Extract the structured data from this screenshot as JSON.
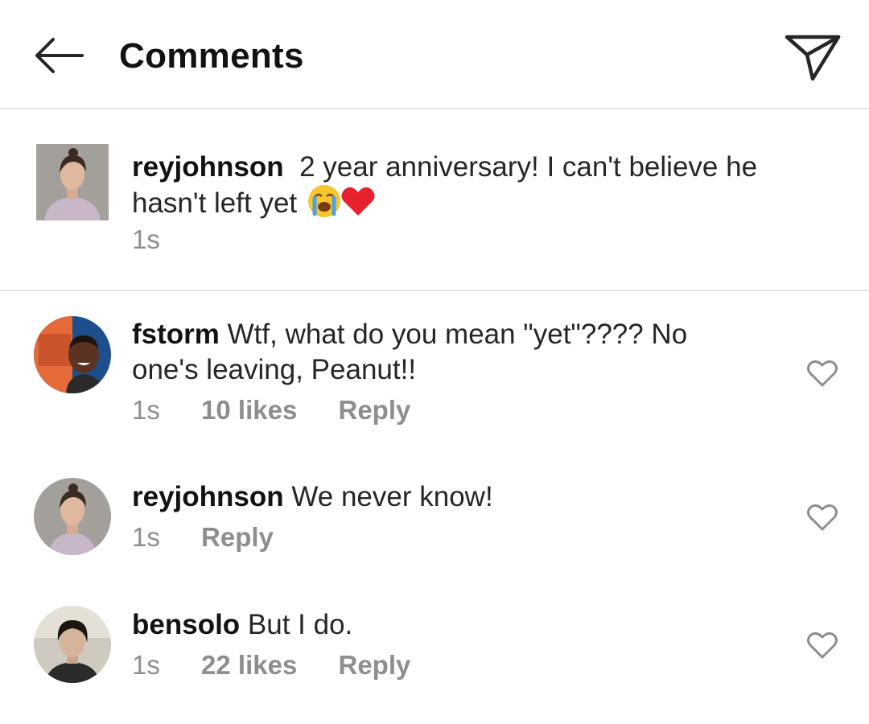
{
  "header": {
    "title": "Comments",
    "back_icon": "arrow-left-icon",
    "send_icon": "paper-plane-icon"
  },
  "caption": {
    "username": "reyjohnson",
    "text": "2 year anniversary! I can't believe he hasn't left yet",
    "emoji": [
      "loudly-crying-face",
      "red-heart"
    ],
    "time": "1s"
  },
  "comments": [
    {
      "username": "fstorm",
      "text": "Wtf, what do you mean \"yet\"???? No one's leaving, Peanut!!",
      "time": "1s",
      "likes": "10 likes",
      "reply": "Reply"
    },
    {
      "username": "reyjohnson",
      "text": "We never know!",
      "time": "1s",
      "reply": "Reply"
    },
    {
      "username": "bensolo",
      "text": "But I do.",
      "time": "1s",
      "likes": "22 likes",
      "reply": "Reply"
    }
  ],
  "colors": {
    "text": "#262626",
    "meta": "#8e8e8e",
    "divider": "#e3e3e3"
  }
}
